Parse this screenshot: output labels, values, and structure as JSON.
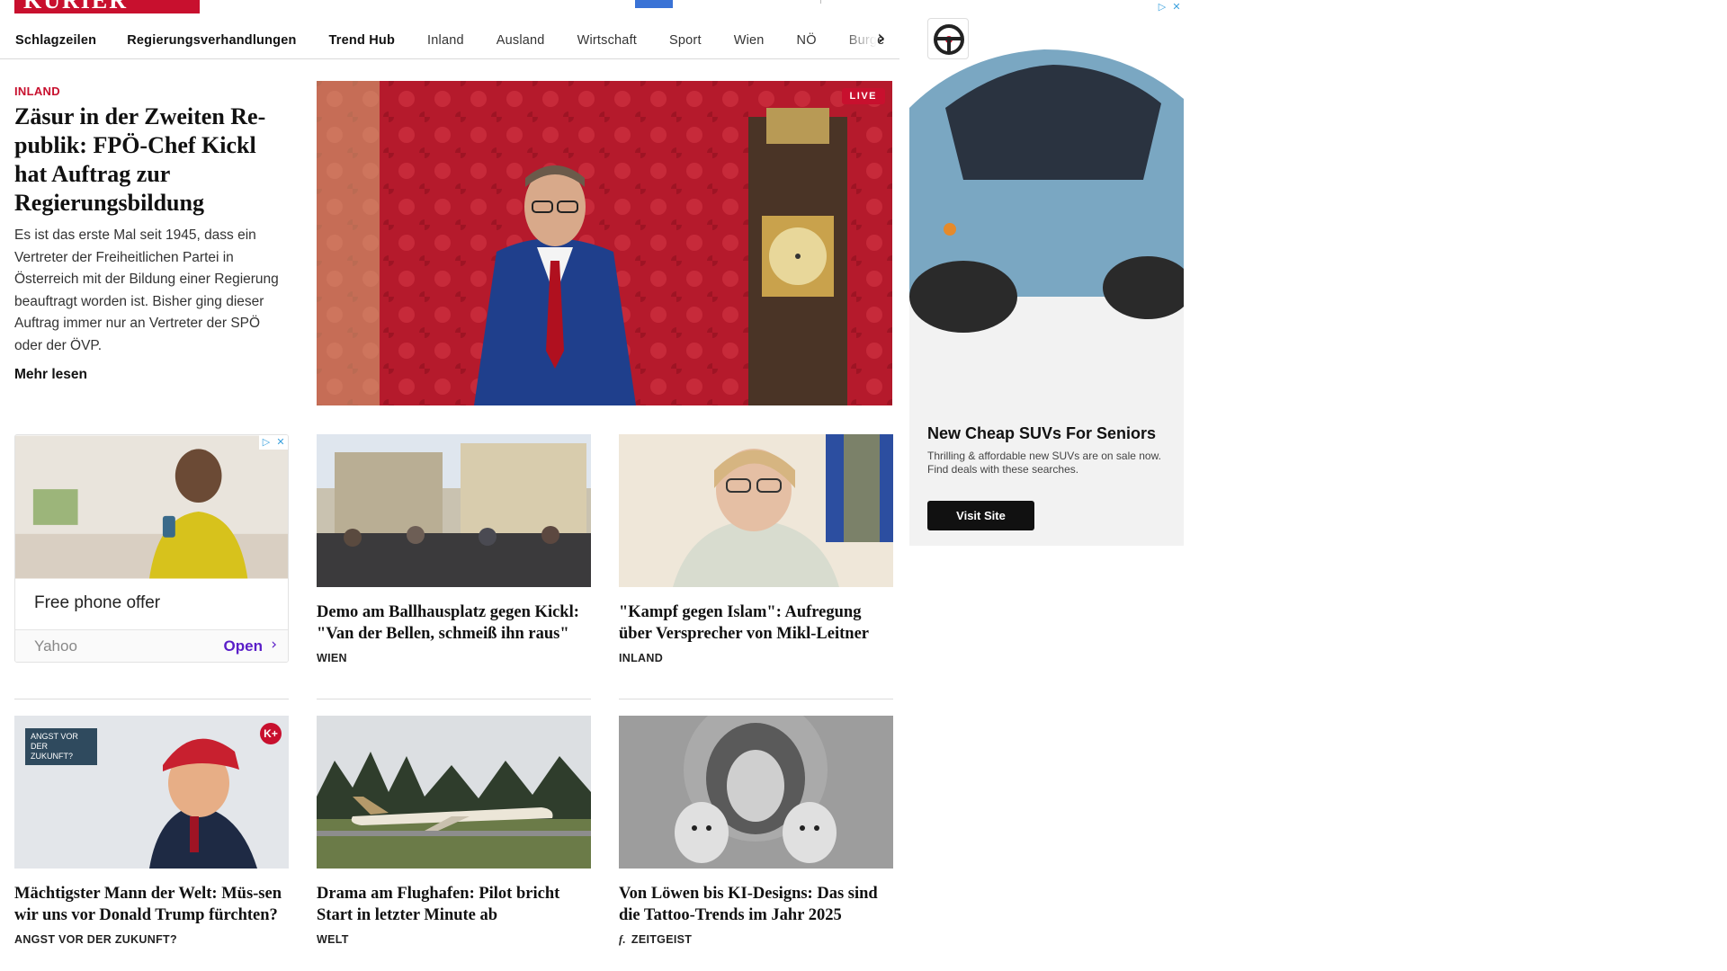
{
  "header": {
    "logo_text": "KURIER"
  },
  "nav": {
    "items": [
      {
        "label": "Schlagzeilen",
        "bold": true
      },
      {
        "label": "Regierungsverhandlungen",
        "bold": true
      },
      {
        "label": "Trend Hub",
        "bold": true
      },
      {
        "label": "Inland",
        "bold": false
      },
      {
        "label": "Ausland",
        "bold": false
      },
      {
        "label": "Wirtschaft",
        "bold": false
      },
      {
        "label": "Sport",
        "bold": false
      },
      {
        "label": "Wien",
        "bold": false
      },
      {
        "label": "NÖ",
        "bold": false
      },
      {
        "label": "Burge",
        "bold": false
      }
    ],
    "next_icon": "chevron-right-icon"
  },
  "lead": {
    "kicker": "INLAND",
    "title": "Zäsur in der Zweiten Re-publik: FPÖ-Chef Kickl hat Auftrag zur Regierungsbildung",
    "text": "Es ist das erste Mal seit 1945, dass ein Vertreter der Freiheitlichen Partei in Österreich mit der Bildung einer Regierung beauftragt worden ist. Bisher ging dieser Auftrag immer nur an Vertreter der SPÖ oder der ÖVP.",
    "more": "Mehr lesen",
    "live_label": "LIVE"
  },
  "ad_left": {
    "title": "Free phone offer",
    "source": "Yahoo",
    "cta": "Open"
  },
  "cards": [
    {
      "title": "Demo am Ballhausplatz gegen Kickl: \"Van der Bellen, schmeiß ihn raus\"",
      "section": "WIEN"
    },
    {
      "title": "\"Kampf gegen Islam\": Aufregung über Versprecher von Mikl-Leitner",
      "section": "INLAND"
    },
    {
      "title": "Mächtigster Mann der Welt: Müs-sen wir uns vor Donald Trump fürchten?",
      "section": "ANGST VOR DER ZUKUNFT?",
      "badge": "ANGST VOR DER ZUKUNFT?",
      "premium": "K+"
    },
    {
      "title": "Drama am Flughafen: Pilot bricht Start in letzter Minute ab",
      "section": "WELT"
    },
    {
      "title": "Von Löwen bis KI-Designs: Das sind die Tattoo-Trends im Jahr 2025",
      "section": "ZEITGEIST",
      "section_prefix": "f."
    }
  ],
  "ad_right": {
    "title": "New Cheap SUVs For Seniors",
    "text": "Thrilling & affordable new SUVs are on sale now. Find deals with these searches.",
    "cta": "Visit Site"
  },
  "colors": {
    "brand": "#c8102e",
    "ad_cta": "#5a1ec8"
  }
}
